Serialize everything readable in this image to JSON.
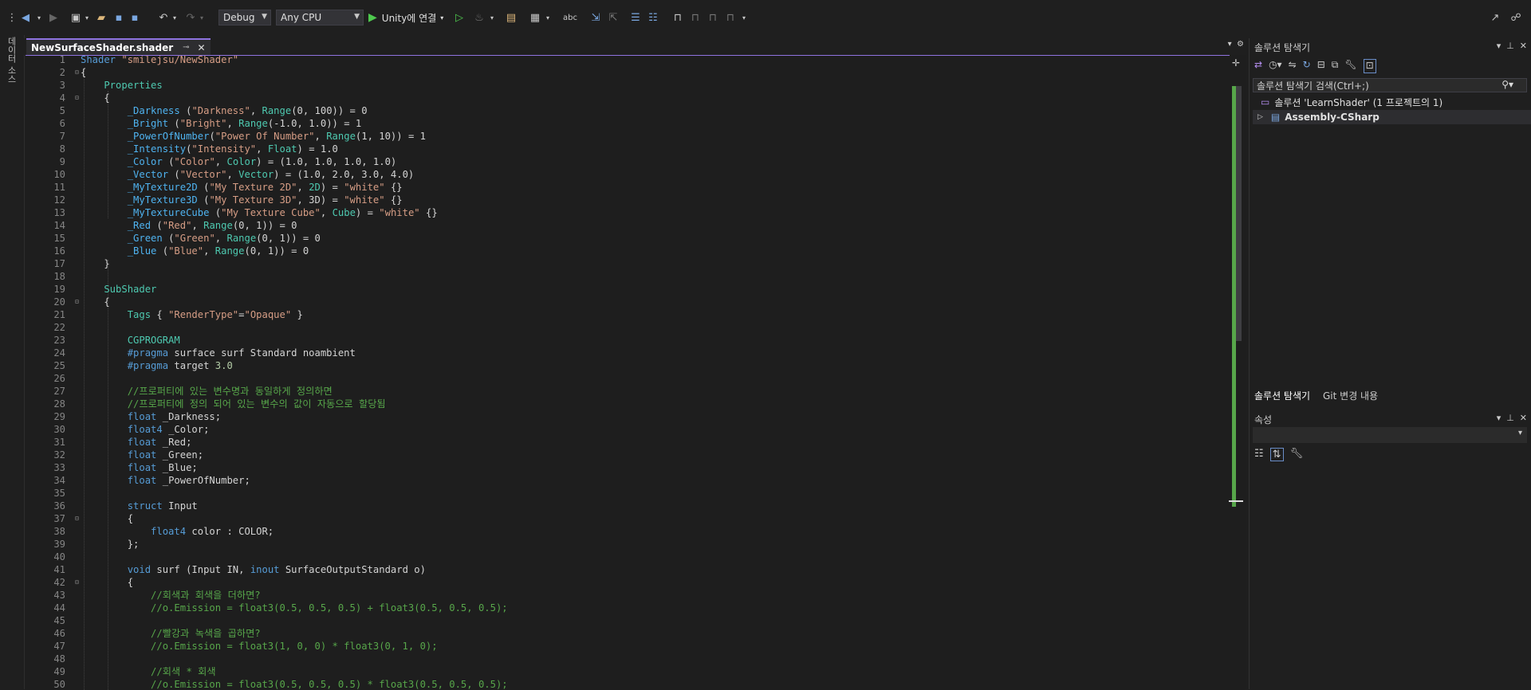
{
  "toolbar": {
    "config": "Debug",
    "platform": "Any CPU",
    "run_label": "Unity에 연결"
  },
  "left_tool_tab": "데이터 소스",
  "editor": {
    "tab_title": "NewSurfaceShader.shader",
    "lines": [
      [
        [
          "kw",
          "Shader "
        ],
        [
          "str",
          "\"smilejsu/NewShader\""
        ]
      ],
      [
        [
          "t",
          "{"
        ]
      ],
      [
        [
          "ty",
          "    Properties"
        ]
      ],
      [
        [
          "t",
          "    {"
        ]
      ],
      [
        [
          "prop",
          "        _Darkness"
        ],
        [
          "t",
          " ("
        ],
        [
          "str",
          "\"Darkness\""
        ],
        [
          "t",
          ", "
        ],
        [
          "ty",
          "Range"
        ],
        [
          "t",
          "(0, 100)) = 0"
        ]
      ],
      [
        [
          "prop",
          "        _Bright"
        ],
        [
          "t",
          " ("
        ],
        [
          "str",
          "\"Bright\""
        ],
        [
          "t",
          ", "
        ],
        [
          "ty",
          "Range"
        ],
        [
          "t",
          "(-1.0, 1.0)) = 1"
        ]
      ],
      [
        [
          "prop",
          "        _PowerOfNumber"
        ],
        [
          "t",
          "("
        ],
        [
          "str",
          "\"Power Of Number\""
        ],
        [
          "t",
          ", "
        ],
        [
          "ty",
          "Range"
        ],
        [
          "t",
          "(1, 10)) = 1"
        ]
      ],
      [
        [
          "prop",
          "        _Intensity"
        ],
        [
          "t",
          "("
        ],
        [
          "str",
          "\"Intensity\""
        ],
        [
          "t",
          ", "
        ],
        [
          "ty",
          "Float"
        ],
        [
          "t",
          ") = 1.0"
        ]
      ],
      [
        [
          "prop",
          "        _Color"
        ],
        [
          "t",
          " ("
        ],
        [
          "str",
          "\"Color\""
        ],
        [
          "t",
          ", "
        ],
        [
          "ty",
          "Color"
        ],
        [
          "t",
          ") = (1.0, 1.0, 1.0, 1.0)"
        ]
      ],
      [
        [
          "prop",
          "        _Vector"
        ],
        [
          "t",
          " ("
        ],
        [
          "str",
          "\"Vector\""
        ],
        [
          "t",
          ", "
        ],
        [
          "ty",
          "Vector"
        ],
        [
          "t",
          ") = (1.0, 2.0, 3.0, 4.0)"
        ]
      ],
      [
        [
          "prop",
          "        _MyTexture2D"
        ],
        [
          "t",
          " ("
        ],
        [
          "str",
          "\"My Texture 2D\""
        ],
        [
          "t",
          ", "
        ],
        [
          "ty",
          "2D"
        ],
        [
          "t",
          ") = "
        ],
        [
          "str",
          "\"white\""
        ],
        [
          "t",
          " {}"
        ]
      ],
      [
        [
          "prop",
          "        _MyTexture3D"
        ],
        [
          "t",
          " ("
        ],
        [
          "str",
          "\"My Texture 3D\""
        ],
        [
          "t",
          ", 3D) = "
        ],
        [
          "str",
          "\"white\""
        ],
        [
          "t",
          " {}"
        ]
      ],
      [
        [
          "prop",
          "        _MyTextureCube"
        ],
        [
          "t",
          " ("
        ],
        [
          "str",
          "\"My Texture Cube\""
        ],
        [
          "t",
          ", "
        ],
        [
          "ty",
          "Cube"
        ],
        [
          "t",
          ") = "
        ],
        [
          "str",
          "\"white\""
        ],
        [
          "t",
          " {}"
        ]
      ],
      [
        [
          "prop",
          "        _Red"
        ],
        [
          "t",
          " ("
        ],
        [
          "str",
          "\"Red\""
        ],
        [
          "t",
          ", "
        ],
        [
          "ty",
          "Range"
        ],
        [
          "t",
          "(0, 1)) = 0"
        ]
      ],
      [
        [
          "prop",
          "        _Green"
        ],
        [
          "t",
          " ("
        ],
        [
          "str",
          "\"Green\""
        ],
        [
          "t",
          ", "
        ],
        [
          "ty",
          "Range"
        ],
        [
          "t",
          "(0, 1)) = 0"
        ]
      ],
      [
        [
          "prop",
          "        _Blue"
        ],
        [
          "t",
          " ("
        ],
        [
          "str",
          "\"Blue\""
        ],
        [
          "t",
          ", "
        ],
        [
          "ty",
          "Range"
        ],
        [
          "t",
          "(0, 1)) = 0"
        ]
      ],
      [
        [
          "t",
          "    }"
        ]
      ],
      [
        [
          "t",
          ""
        ]
      ],
      [
        [
          "ty",
          "    SubShader"
        ]
      ],
      [
        [
          "t",
          "    {"
        ]
      ],
      [
        [
          "ty",
          "        Tags"
        ],
        [
          "t",
          " { "
        ],
        [
          "str",
          "\"RenderType\""
        ],
        [
          "t",
          "="
        ],
        [
          "str",
          "\"Opaque\""
        ],
        [
          "t",
          " }"
        ]
      ],
      [
        [
          "t",
          ""
        ]
      ],
      [
        [
          "ty",
          "        CGPROGRAM"
        ]
      ],
      [
        [
          "kw",
          "        #pragma"
        ],
        [
          "t",
          " surface surf Standard noambient"
        ]
      ],
      [
        [
          "kw",
          "        #pragma"
        ],
        [
          "t",
          " target "
        ],
        [
          "num",
          "3.0"
        ]
      ],
      [
        [
          "t",
          ""
        ]
      ],
      [
        [
          "cm",
          "        //프로퍼티에 있는 변수명과 동일하게 정의하면"
        ]
      ],
      [
        [
          "cm",
          "        //프로퍼티에 정의 되어 있는 변수의 값이 자동으로 할당됨"
        ]
      ],
      [
        [
          "kw",
          "        float"
        ],
        [
          "t",
          " _Darkness;"
        ]
      ],
      [
        [
          "kw",
          "        float4"
        ],
        [
          "t",
          " _Color;"
        ]
      ],
      [
        [
          "kw",
          "        float"
        ],
        [
          "t",
          " _Red;"
        ]
      ],
      [
        [
          "kw",
          "        float"
        ],
        [
          "t",
          " _Green;"
        ]
      ],
      [
        [
          "kw",
          "        float"
        ],
        [
          "t",
          " _Blue;"
        ]
      ],
      [
        [
          "kw",
          "        float"
        ],
        [
          "t",
          " _PowerOfNumber;"
        ]
      ],
      [
        [
          "t",
          ""
        ]
      ],
      [
        [
          "kw",
          "        struct"
        ],
        [
          "t",
          " Input"
        ]
      ],
      [
        [
          "t",
          "        {"
        ]
      ],
      [
        [
          "kw",
          "            float4"
        ],
        [
          "t",
          " color : COLOR;"
        ]
      ],
      [
        [
          "t",
          "        };"
        ]
      ],
      [
        [
          "t",
          ""
        ]
      ],
      [
        [
          "kw",
          "        void"
        ],
        [
          "t",
          " surf (Input IN, "
        ],
        [
          "kw",
          "inout"
        ],
        [
          "t",
          " SurfaceOutputStandard o)"
        ]
      ],
      [
        [
          "t",
          "        {"
        ]
      ],
      [
        [
          "cm",
          "            //회색과 회색을 더하면?"
        ]
      ],
      [
        [
          "cm",
          "            //o.Emission = float3(0.5, 0.5, 0.5) + float3(0.5, 0.5, 0.5);"
        ]
      ],
      [
        [
          "t",
          ""
        ]
      ],
      [
        [
          "cm",
          "            //빨강과 녹색을 곱하면?"
        ]
      ],
      [
        [
          "cm",
          "            //o.Emission = float3(1, 0, 0) * float3(0, 1, 0);"
        ]
      ],
      [
        [
          "t",
          ""
        ]
      ],
      [
        [
          "cm",
          "            //회색 * 회색"
        ]
      ],
      [
        [
          "cm",
          "            //o.Emission = float3(0.5, 0.5, 0.5) * float3(0.5, 0.5, 0.5);"
        ]
      ]
    ]
  },
  "solution_explorer": {
    "title": "솔루션 탐색기",
    "search_placeholder": "솔루션 탐색기 검색(Ctrl+;)",
    "solution_label": "솔루션 'LearnShader' (1 프로젝트의 1)",
    "project_label": "Assembly-CSharp",
    "bottom_tabs": [
      "솔루션 탐색기",
      "Git 변경 내용"
    ]
  },
  "properties": {
    "title": "속성"
  },
  "colors": {
    "accent": "#8f73e0",
    "change_bar": "#57a64a"
  }
}
